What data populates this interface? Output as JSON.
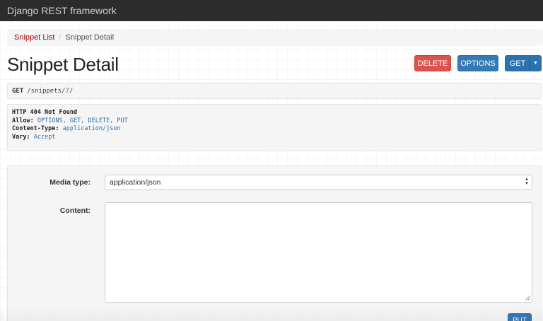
{
  "navbar": {
    "brand": "Django REST framework"
  },
  "breadcrumb": {
    "items": [
      "Snippet List",
      "Snippet Detail"
    ],
    "separator": "/"
  },
  "page": {
    "title": "Snippet Detail"
  },
  "actions": {
    "delete_label": "DELETE",
    "options_label": "OPTIONS",
    "get_label": "GET",
    "caret": "▼"
  },
  "request": {
    "method": "GET",
    "path_prefix": "/snippets/",
    "path_id": "7",
    "path_suffix": "/"
  },
  "response": {
    "status": "HTTP 404 Not Found",
    "headers": [
      {
        "name": "Allow:",
        "value": "OPTIONS, GET, DELETE, PUT"
      },
      {
        "name": "Content-Type:",
        "value": "application/json"
      },
      {
        "name": "Vary:",
        "value": "Accept"
      }
    ]
  },
  "form": {
    "media_type_label": "Media type:",
    "media_type_value": "application/json",
    "content_label": "Content:",
    "submit_label": "PUT"
  },
  "colors": {
    "navbar": "#2c2c2c",
    "link": "#a30000",
    "primary": "#337ab7",
    "danger": "#d9534f"
  }
}
